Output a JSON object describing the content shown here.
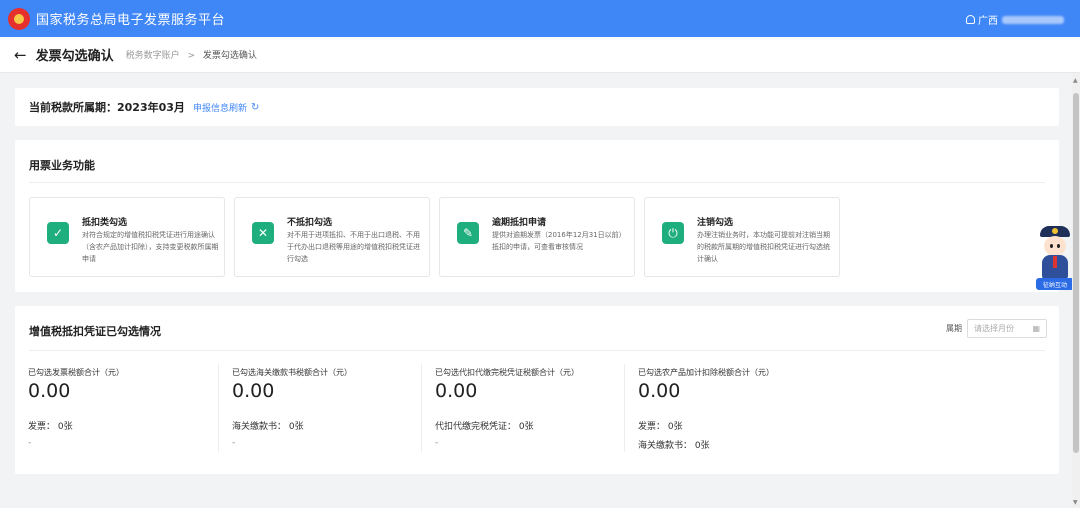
{
  "header": {
    "app_title": "国家税务总局电子发票服务平台",
    "user_prefix": "广西"
  },
  "breadcrumb": {
    "back_icon": "←",
    "page_title": "发票勾选确认",
    "parent": "税务数字账户",
    "separator": ">",
    "current": "发票勾选确认"
  },
  "period": {
    "label": "当前税款所属期：2023年03月",
    "refresh_label": "申报信息刷新",
    "refresh_icon": "↻"
  },
  "business": {
    "title": "用票业务功能",
    "items": [
      {
        "name": "抵扣类勾选",
        "desc": "对符合规定的增值税扣税凭证进行用途确认（含农产品加计扣除），支持变更税款所属期申请",
        "icon": "✓"
      },
      {
        "name": "不抵扣勾选",
        "desc": "对不用于进项抵扣、不用于出口退税、不用于代办出口退税等用途的增值税扣税凭证进行勾选",
        "icon": "✕"
      },
      {
        "name": "逾期抵扣申请",
        "desc": "提供对逾期发票（2016年12月31日以前）抵扣的申请，可查看审核情况",
        "icon": "✎"
      },
      {
        "name": "注销勾选",
        "desc": "办理注销业务时，本功能可提前对注销当期的税款所属期的增值税扣税凭证进行勾选统计确认",
        "icon": "⏻"
      }
    ]
  },
  "summary": {
    "title": "增值税抵扣凭证已勾选情况",
    "period_label": "属期",
    "month_placeholder": "请选择月份",
    "calendar_icon": "▦",
    "stats": [
      {
        "label": "已勾选发票税额合计（元）",
        "value": "0.00",
        "count1": "发票：  0张",
        "dash": "-"
      },
      {
        "label": "已勾选海关缴款书税额合计（元）",
        "value": "0.00",
        "count1": "海关缴款书：  0张",
        "dash": "-"
      },
      {
        "label": "已勾选代扣代缴完税凭证税额合计（元）",
        "value": "0.00",
        "count1": "代扣代缴完税凭证：  0张",
        "dash": "-"
      },
      {
        "label": "已勾选农产品加计扣除税额合计（元）",
        "value": "0.00",
        "count1": "发票：  0张",
        "count2": "海关缴款书：  0张"
      }
    ]
  },
  "mascot": {
    "badge": "征纳互动"
  },
  "scrollbar": {
    "up": "▲",
    "down": "▼"
  }
}
